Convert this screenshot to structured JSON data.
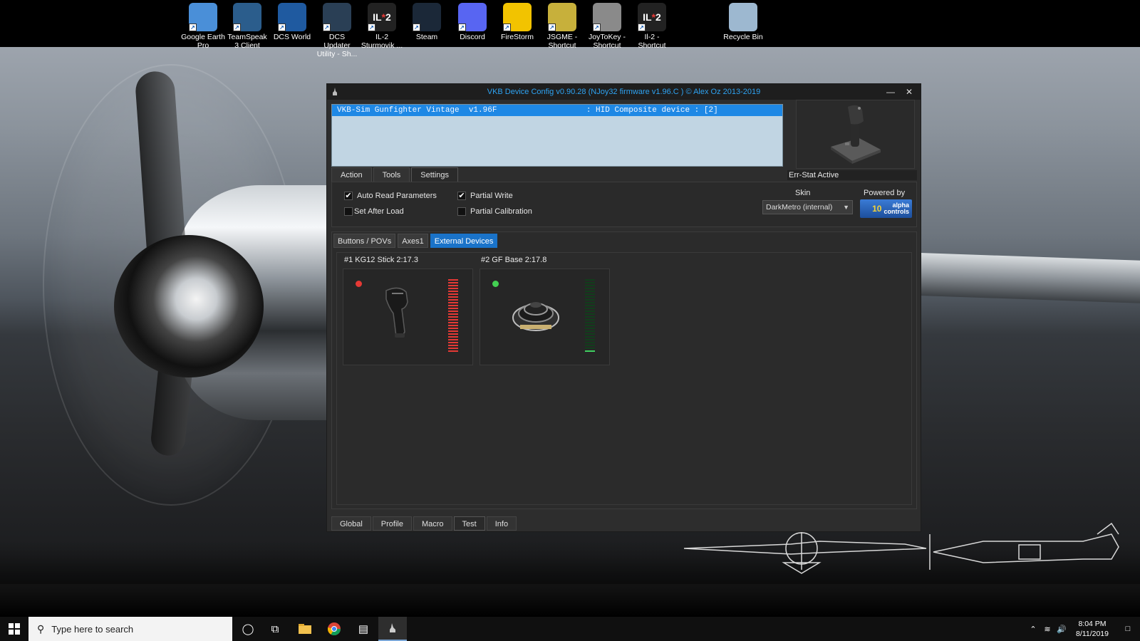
{
  "desktop": {
    "icons": [
      {
        "label": "Google Earth Pro",
        "icon": "google-earth-icon",
        "color": "#4a8fd8"
      },
      {
        "label": "TeamSpeak 3 Client",
        "icon": "teamspeak-icon",
        "color": "#2b5d8c"
      },
      {
        "label": "DCS World",
        "icon": "dcs-world-icon",
        "color": "#1f5aa0"
      },
      {
        "label": "DCS Updater Utility - Sh...",
        "icon": "dcs-updater-icon",
        "color": "#2a3f55"
      },
      {
        "label": "IL-2 Sturmovik ...",
        "icon": "il2-icon",
        "color": "#222222"
      },
      {
        "label": "Steam",
        "icon": "steam-icon",
        "color": "#1b2838"
      },
      {
        "label": "Discord",
        "icon": "discord-icon",
        "color": "#5865f2"
      },
      {
        "label": "FireStorm",
        "icon": "firestorm-icon",
        "color": "#f2c300"
      },
      {
        "label": "JSGME - Shortcut",
        "icon": "jsgme-icon",
        "color": "#c7b03b"
      },
      {
        "label": "JoyToKey - Shortcut",
        "icon": "joytokey-icon",
        "color": "#8a8a8a"
      },
      {
        "label": "Il-2 - Shortcut",
        "icon": "il2-shortcut-icon",
        "color": "#222222"
      },
      {
        "label": "Recycle Bin",
        "icon": "recycle-bin-icon",
        "color": "#9db8d0"
      }
    ],
    "il2_text": "IL",
    "il2_num": "2"
  },
  "window": {
    "title": "VKB Device Config v0.90.28 (NJoy32 firmware v1.96.C  ) © Alex Oz 2013-2019",
    "device_row": "VKB-Sim Gunfighter Vintage  v1.96F                   : HID Composite device : [2]",
    "err_stat": "Err-Stat Active",
    "top_tabs": [
      "Action",
      "Tools",
      "Settings"
    ],
    "active_top_tab": "Settings",
    "settings": {
      "auto_read": {
        "label": "Auto Read Parameters",
        "checked": true
      },
      "set_after_load": {
        "label": "Set After Load",
        "checked": false
      },
      "partial_write": {
        "label": "Partial Write",
        "checked": true
      },
      "partial_calibration": {
        "label": "Partial Calibration",
        "checked": false
      },
      "skin_label": "Skin",
      "skin_value": "DarkMetro (internal)",
      "powered_label": "Powered by",
      "alpha_logo_text": "10 alpha controls"
    },
    "sub_tabs": [
      "Buttons / POVs",
      "Axes1",
      "External Devices"
    ],
    "active_sub_tab": "External Devices",
    "external_devices": [
      {
        "label": "#1 KG12 Stick 2:17.3",
        "led_color": "#e53935",
        "meter_color": "#e53935",
        "meter_level": 1.0
      },
      {
        "label": "#2 GF Base 2:17.8",
        "led_color": "#43d052",
        "meter_color": "#2ea043",
        "meter_level": 0.02
      }
    ],
    "bottom_tabs": [
      "Global",
      "Profile",
      "Macro",
      "Test",
      "Info"
    ],
    "active_bottom_tab": "Test"
  },
  "taskbar": {
    "search_placeholder": "Type here to search",
    "time": "8:04 PM",
    "date": "8/11/2019"
  }
}
